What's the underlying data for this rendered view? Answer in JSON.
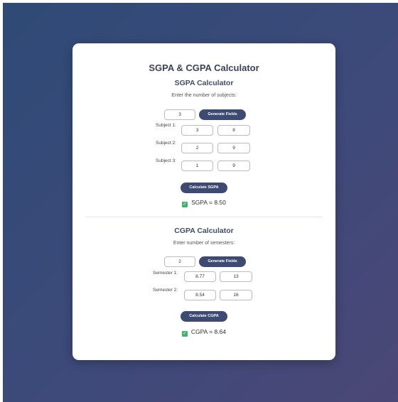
{
  "page_title": "SGPA & CGPA Calculator",
  "sgpa": {
    "heading": "SGPA Calculator",
    "prompt": "Enter the number of subjects:",
    "count_value": "3",
    "generate_label": "Generate Fields",
    "subjects": [
      {
        "label": "Subject 1:",
        "credits": "3",
        "grade": "8"
      },
      {
        "label": "Subject 2:",
        "credits": "2",
        "grade": "9"
      },
      {
        "label": "Subject 3:",
        "credits": "1",
        "grade": "9"
      }
    ],
    "calculate_label": "Calculate SGPA",
    "result": "SGPA = 8.50"
  },
  "cgpa": {
    "heading": "CGPA Calculator",
    "prompt": "Enter number of semesters:",
    "count_value": "2",
    "generate_label": "Generate Fields",
    "semesters": [
      {
        "label": "Semester 1:",
        "sgpa": "8.77",
        "credits": "13"
      },
      {
        "label": "Semester 2:",
        "sgpa": "8.54",
        "credits": "16"
      }
    ],
    "calculate_label": "Calculate CGPA",
    "result": "CGPA = 8.64"
  },
  "colors": {
    "accent": "#3d4b72",
    "check": "#3fb36b"
  },
  "icons": {
    "result_check": "check-mark-icon",
    "check_glyph": "✓"
  }
}
